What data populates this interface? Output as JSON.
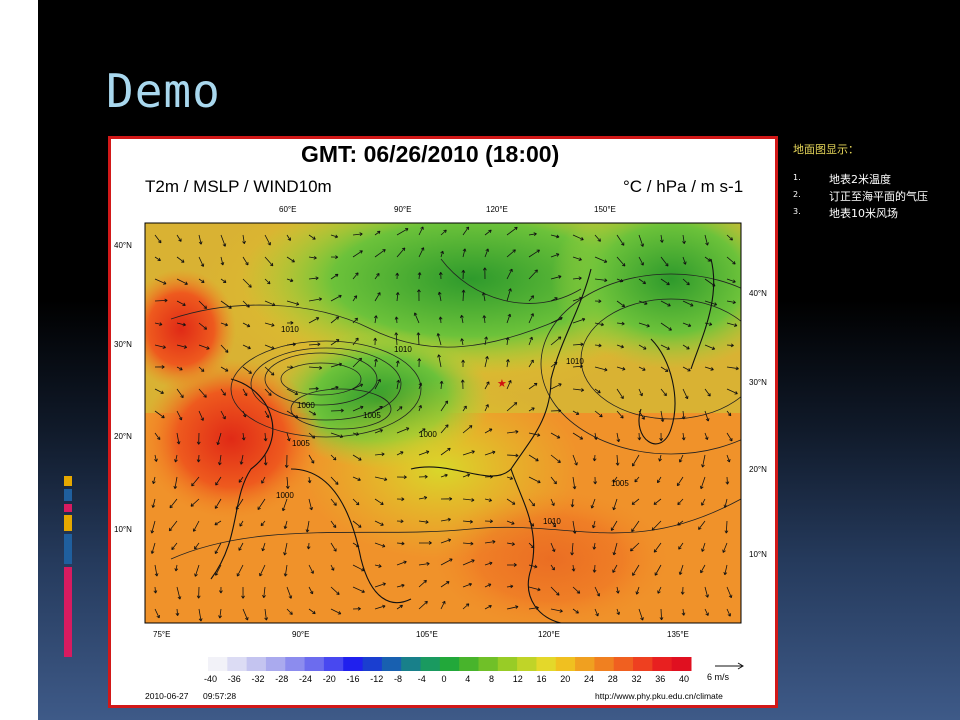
{
  "slide": {
    "title": "Demo",
    "background": "#000000",
    "title_color": "#a9d8ee",
    "accent_colors": [
      "#e6a800",
      "#1f5f9e",
      "#d81b60"
    ]
  },
  "figure": {
    "title": "GMT: 06/26/2010 (18:00)",
    "variables": "T2m / MSLP / WIND10m",
    "units": "°C / hPa / m s-1",
    "border_color": "#d21818",
    "top_lon_ticks": [
      "60°E",
      "90°E",
      "120°E",
      "150°E"
    ],
    "bottom_lon_ticks": [
      "75°E",
      "90°E",
      "105°E",
      "120°E",
      "135°E"
    ],
    "left_lat_ticks": [
      "40°N",
      "30°N",
      "20°N",
      "10°N"
    ],
    "right_lat_ticks": [
      "40°N",
      "30°N",
      "20°N",
      "10°N"
    ],
    "isobar_labels": [
      "1010",
      "1010",
      "1000",
      "1005",
      "1005",
      "1000",
      "1000",
      "1010",
      "1005",
      "1010"
    ],
    "colorbar_labels": [
      "-40",
      "-36",
      "-32",
      "-28",
      "-24",
      "-20",
      "-16",
      "-12",
      "-8",
      "-4",
      "0",
      "4",
      "8",
      "12",
      "16",
      "20",
      "24",
      "28",
      "32",
      "36",
      "40"
    ],
    "wind_scale": "6 m/s",
    "date_stamp": "2010-06-27",
    "time_stamp": "09:57:28",
    "source_url": "http://www.phy.pku.edu.cn/climate"
  },
  "notes": {
    "heading": "地面图显示：",
    "items": [
      {
        "num": "1.",
        "text": "地表2米温度"
      },
      {
        "num": "2.",
        "text": "订正至海平面的气压"
      },
      {
        "num": "3.",
        "text": "地表10米风场"
      }
    ]
  }
}
